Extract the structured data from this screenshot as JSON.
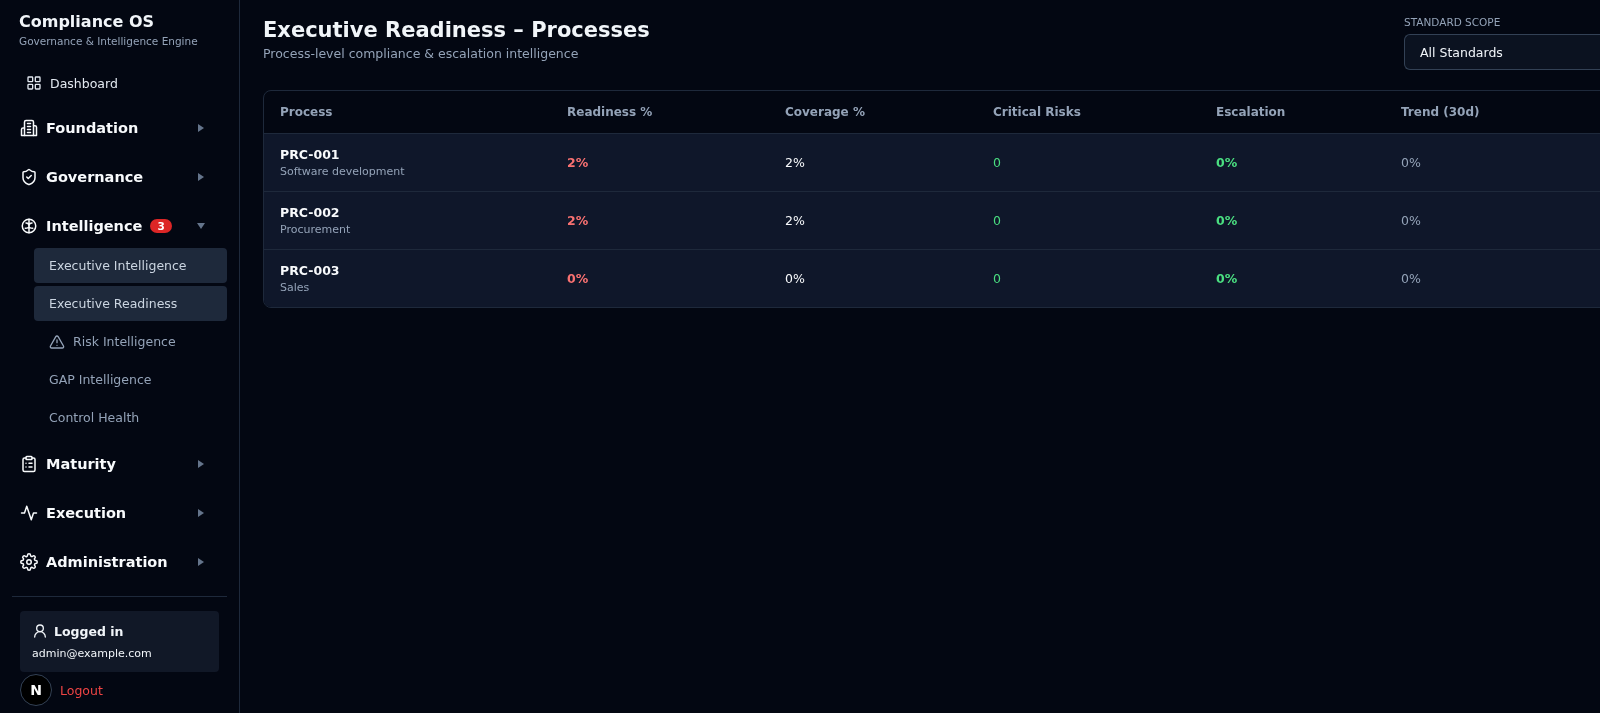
{
  "sidebar": {
    "app_title": "Compliance OS",
    "app_subtitle": "Governance & Intelligence Engine",
    "items": [
      {
        "kind": "link",
        "label": "Dashboard"
      },
      {
        "kind": "group",
        "label": "Foundation",
        "expanded": false
      },
      {
        "kind": "group",
        "label": "Governance",
        "expanded": false
      },
      {
        "kind": "group",
        "label": "Intelligence",
        "expanded": true,
        "badge": "3",
        "children": [
          {
            "kind": "plain",
            "label": "Executive Intelligence",
            "selected": true
          },
          {
            "kind": "plain",
            "label": "Executive Readiness",
            "selected": true
          },
          {
            "kind": "warning",
            "label": "Risk Intelligence",
            "selected": false
          },
          {
            "kind": "plain",
            "label": "GAP Intelligence",
            "selected": false
          },
          {
            "kind": "plain",
            "label": "Control Health",
            "selected": false
          }
        ]
      },
      {
        "kind": "group",
        "label": "Maturity",
        "expanded": false
      },
      {
        "kind": "group",
        "label": "Execution",
        "expanded": false
      },
      {
        "kind": "group",
        "label": "Administration",
        "expanded": false
      }
    ],
    "user_card": {
      "title": "Logged in",
      "email": "admin@example.com"
    },
    "logout": "Logout",
    "dev_badge": "N"
  },
  "header": {
    "title": "Executive Readiness – Processes",
    "subtitle": "Process-level compliance & escalation intelligence"
  },
  "scope": {
    "label": "STANDARD SCOPE",
    "value": "All Standards"
  },
  "table": {
    "columns": [
      "Process",
      "Readiness %",
      "Coverage %",
      "Critical Risks",
      "Escalation",
      "Trend (30d)"
    ],
    "rows": [
      {
        "id": "PRC-001",
        "name": "Software development",
        "readiness": "2%",
        "coverage": "2%",
        "critical_risks": "0",
        "escalation": "0%",
        "trend": "0%"
      },
      {
        "id": "PRC-002",
        "name": "Procurement",
        "readiness": "2%",
        "coverage": "2%",
        "critical_risks": "0",
        "escalation": "0%",
        "trend": "0%"
      },
      {
        "id": "PRC-003",
        "name": "Sales",
        "readiness": "0%",
        "coverage": "0%",
        "critical_risks": "0",
        "escalation": "0%",
        "trend": "0%"
      }
    ]
  }
}
